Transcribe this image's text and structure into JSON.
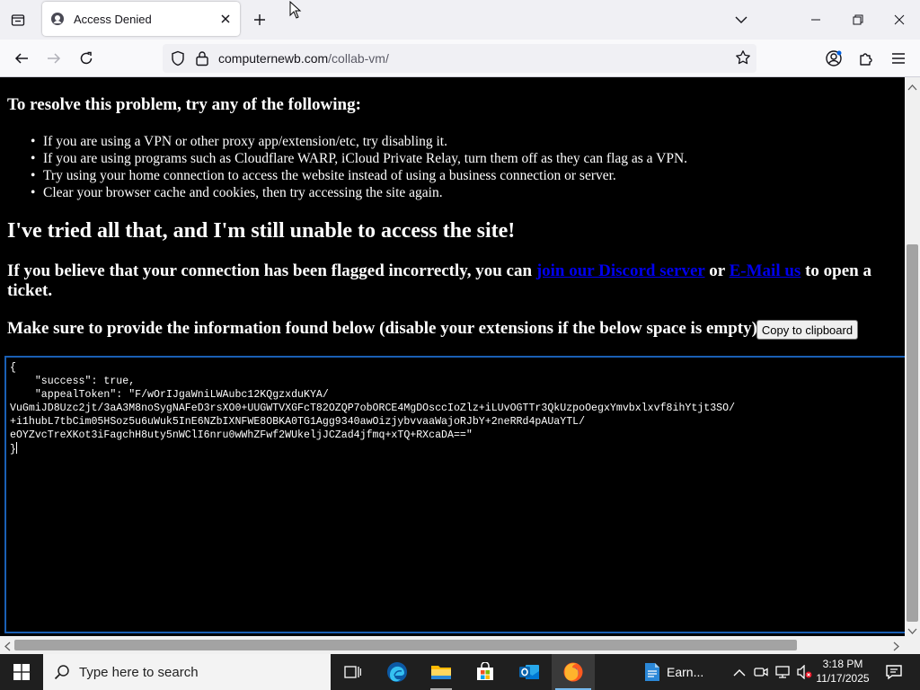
{
  "browser": {
    "tab_title": "Access Denied",
    "url_domain": "computernewb.com",
    "url_path": "/collab-vm/"
  },
  "page": {
    "resolve_heading": "To resolve this problem, try any of the following:",
    "tips": [
      "If you are using a VPN or other proxy app/extension/etc, try disabling it.",
      "If you are using programs such as Cloudflare WARP, iCloud Private Relay, turn them off as they can flag as a VPN.",
      "Try using your home connection to access the website instead of using a business connection or server.",
      "Clear your browser cache and cookies, then try accessing the site again."
    ],
    "tried_heading": "I've tried all that, and I'm still unable to access the site!",
    "flag_text_1": "If you believe that your connection has been flagged incorrectly, you can ",
    "discord_link": "join our Discord server",
    "flag_text_2": " or ",
    "email_link": "E-Mail us",
    "flag_text_3": " to open a ticket.",
    "info_text": "Make sure to provide the information found below (disable your extensions if the below space is empty):",
    "copy_button": "Copy to clipboard",
    "info_box": "{\n    \"success\": true,\n    \"appealToken\": \"F/wOrIJgaWniLWAubc12KQgzxduKYA/\nVuGmiJD8Uzc2jt/3aA3M8noSygNAFeD3rsXO0+UUGWTVXGFcT82OZQP7obORCE4MgDOsccIoZlz+iLUvOGTTr3QkUzpoOegxYmvbxlxvf8ihYtjt3SO/\n+i1hubL7tbCim05HSoz5u6uWuk5InE6NZbIXNFWE8OBKA0TG1Agg9340awOizjybvvaaWajoRJbY+2neRRd4pAUaYTL/\neOYZvcTreXKot3iFagchH8uty5nWClI6nru0wWhZFwf2WUkeljJCZad4jfmq+xTQ+RXcaDA==\"\n}"
  },
  "taskbar": {
    "search_placeholder": "Type here to search",
    "earn_label": "Earn...",
    "time": "3:18 PM",
    "date": "11/17/2025"
  },
  "colors": {
    "link": "#0000ee",
    "page_bg": "#000000",
    "taskbar_bg": "#1f1f1f",
    "textarea_border": "#1a5fb4"
  },
  "icons": [
    "tab-list-icon",
    "favicon-icon",
    "close-tab-icon",
    "new-tab-icon",
    "mouse-cursor-icon",
    "chevron-down-icon",
    "minimize-icon",
    "maximize-icon",
    "close-window-icon",
    "back-icon",
    "forward-icon",
    "reload-icon",
    "shield-icon",
    "lock-icon",
    "bookmark-star-icon",
    "account-icon",
    "extensions-icon",
    "menu-icon",
    "windows-start-icon",
    "search-icon",
    "task-view-icon",
    "edge-icon",
    "file-explorer-icon",
    "store-icon",
    "outlook-icon",
    "firefox-icon",
    "earn-app-icon",
    "chevron-up-icon",
    "meet-now-icon",
    "network-icon",
    "volume-muted-icon",
    "notifications-icon"
  ]
}
